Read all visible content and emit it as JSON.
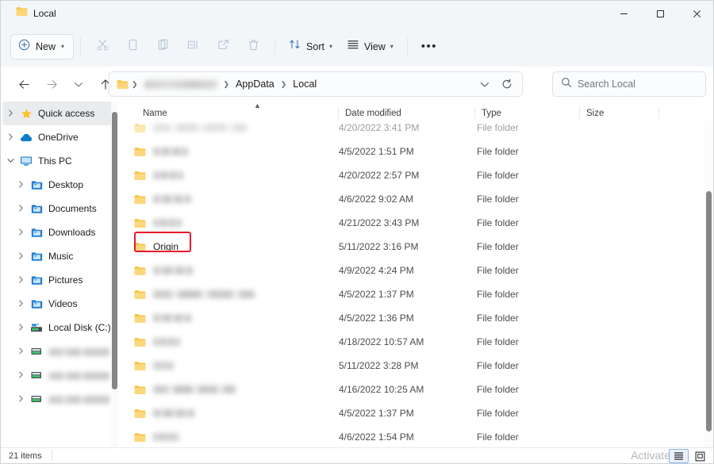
{
  "window": {
    "tab_title": "Local",
    "tab_icon": "folder-icon",
    "minimize_label": "–",
    "maximize_label": "□",
    "close_label": "✕"
  },
  "toolbar": {
    "new_label": "New",
    "new_icon": "plus-circle-icon",
    "cut_icon": "scissors-icon",
    "copy_icon": "copy-icon",
    "paste_icon": "clipboard-icon",
    "rename_icon": "rename-icon",
    "share_icon": "share-icon",
    "delete_icon": "trash-icon",
    "sort_label": "Sort",
    "sort_icon": "sort-arrows-icon",
    "view_label": "View",
    "view_icon": "view-lines-icon",
    "more_label": "•••"
  },
  "addressbar": {
    "back_icon": "arrow-left-icon",
    "forward_icon": "arrow-right-icon",
    "recent_icon": "chevron-down-icon",
    "up_icon": "arrow-up-icon",
    "breadcrumbs": [
      "",
      "AppData",
      "Local"
    ],
    "crumb_blurred_index": 0,
    "dropdown_icon": "chevron-down-icon",
    "refresh_icon": "refresh-icon"
  },
  "search": {
    "placeholder": "Search Local",
    "value": "",
    "icon": "search-icon"
  },
  "sidebar": {
    "items": [
      {
        "label": "Quick access",
        "icon": "star-icon",
        "expander": "›",
        "indent": 0,
        "selected": true,
        "blurred": false
      },
      {
        "label": "OneDrive",
        "icon": "cloud-icon",
        "expander": "›",
        "indent": 0,
        "selected": false,
        "blurred": false
      },
      {
        "label": "This PC",
        "icon": "monitor-icon",
        "expander": "⌄",
        "indent": 0,
        "selected": false,
        "blurred": false
      },
      {
        "label": "Desktop",
        "icon": "folder-blue-icon",
        "expander": "›",
        "indent": 1,
        "selected": false,
        "blurred": false
      },
      {
        "label": "Documents",
        "icon": "folder-blue-icon",
        "expander": "›",
        "indent": 1,
        "selected": false,
        "blurred": false
      },
      {
        "label": "Downloads",
        "icon": "folder-blue-icon",
        "expander": "›",
        "indent": 1,
        "selected": false,
        "blurred": false
      },
      {
        "label": "Music",
        "icon": "folder-blue-icon",
        "expander": "›",
        "indent": 1,
        "selected": false,
        "blurred": false
      },
      {
        "label": "Pictures",
        "icon": "folder-blue-icon",
        "expander": "›",
        "indent": 1,
        "selected": false,
        "blurred": false
      },
      {
        "label": "Videos",
        "icon": "folder-blue-icon",
        "expander": "›",
        "indent": 1,
        "selected": false,
        "blurred": false
      },
      {
        "label": "Local Disk (C:)",
        "icon": "drive-icon",
        "expander": "›",
        "indent": 1,
        "selected": false,
        "blurred": false
      },
      {
        "label": "",
        "icon": "network-drive-icon",
        "expander": "›",
        "indent": 1,
        "selected": false,
        "blurred": true
      },
      {
        "label": "",
        "icon": "network-drive-icon",
        "expander": "›",
        "indent": 1,
        "selected": false,
        "blurred": true
      },
      {
        "label": "",
        "icon": "network-drive-icon",
        "expander": "›",
        "indent": 1,
        "selected": false,
        "blurred": true
      }
    ]
  },
  "filelist": {
    "columns": [
      "Name",
      "Date modified",
      "Type",
      "Size"
    ],
    "sort_column": "Name",
    "sort_direction": "ascending",
    "rows": [
      {
        "name": "ElevatedDiagnostics",
        "date": "4/20/2022 3:41 PM",
        "type": "File folder",
        "size": "",
        "blurred": true,
        "highlighted": false,
        "clipped": true
      },
      {
        "name": "",
        "date": "4/5/2022 1:51 PM",
        "type": "File folder",
        "size": "",
        "blurred": true,
        "highlighted": false,
        "clipped": false
      },
      {
        "name": "",
        "date": "4/20/2022 2:57 PM",
        "type": "File folder",
        "size": "",
        "blurred": true,
        "highlighted": false,
        "clipped": false
      },
      {
        "name": "",
        "date": "4/6/2022 9:02 AM",
        "type": "File folder",
        "size": "",
        "blurred": true,
        "highlighted": false,
        "clipped": false
      },
      {
        "name": "",
        "date": "4/21/2022 3:43 PM",
        "type": "File folder",
        "size": "",
        "blurred": true,
        "highlighted": false,
        "clipped": false
      },
      {
        "name": "Origin",
        "date": "5/11/2022 3:16 PM",
        "type": "File folder",
        "size": "",
        "blurred": false,
        "highlighted": true,
        "clipped": false
      },
      {
        "name": "",
        "date": "4/9/2022 4:24 PM",
        "type": "File folder",
        "size": "",
        "blurred": true,
        "highlighted": false,
        "clipped": false
      },
      {
        "name": "",
        "date": "4/5/2022 1:37 PM",
        "type": "File folder",
        "size": "",
        "blurred": true,
        "highlighted": false,
        "clipped": false
      },
      {
        "name": "",
        "date": "4/5/2022 1:36 PM",
        "type": "File folder",
        "size": "",
        "blurred": true,
        "highlighted": false,
        "clipped": false
      },
      {
        "name": "",
        "date": "4/18/2022 10:57 AM",
        "type": "File folder",
        "size": "",
        "blurred": true,
        "highlighted": false,
        "clipped": false
      },
      {
        "name": "",
        "date": "5/11/2022 3:28 PM",
        "type": "File folder",
        "size": "",
        "blurred": true,
        "highlighted": false,
        "clipped": false
      },
      {
        "name": "",
        "date": "4/16/2022 10:25 AM",
        "type": "File folder",
        "size": "",
        "blurred": true,
        "highlighted": false,
        "clipped": false
      },
      {
        "name": "",
        "date": "4/5/2022 1:37 PM",
        "type": "File folder",
        "size": "",
        "blurred": true,
        "highlighted": false,
        "clipped": false
      },
      {
        "name": "",
        "date": "4/6/2022 1:54 PM",
        "type": "File folder",
        "size": "",
        "blurred": true,
        "highlighted": false,
        "clipped": false
      }
    ],
    "blur_widths": [
      118,
      44,
      38,
      48,
      36,
      0,
      50,
      128,
      48,
      34,
      26,
      104,
      52,
      32
    ]
  },
  "statusbar": {
    "item_count": "21 items",
    "details_view_icon": "details-view-icon",
    "large_icons_view_icon": "large-icons-view-icon",
    "active_view": "details"
  },
  "watermark": {
    "text": "Activate"
  },
  "colors": {
    "accent": "#0067c0",
    "highlight_box": "#e8192c",
    "folder_yellow": "#f6c243",
    "chrome_bg": "#f3f6f9"
  }
}
